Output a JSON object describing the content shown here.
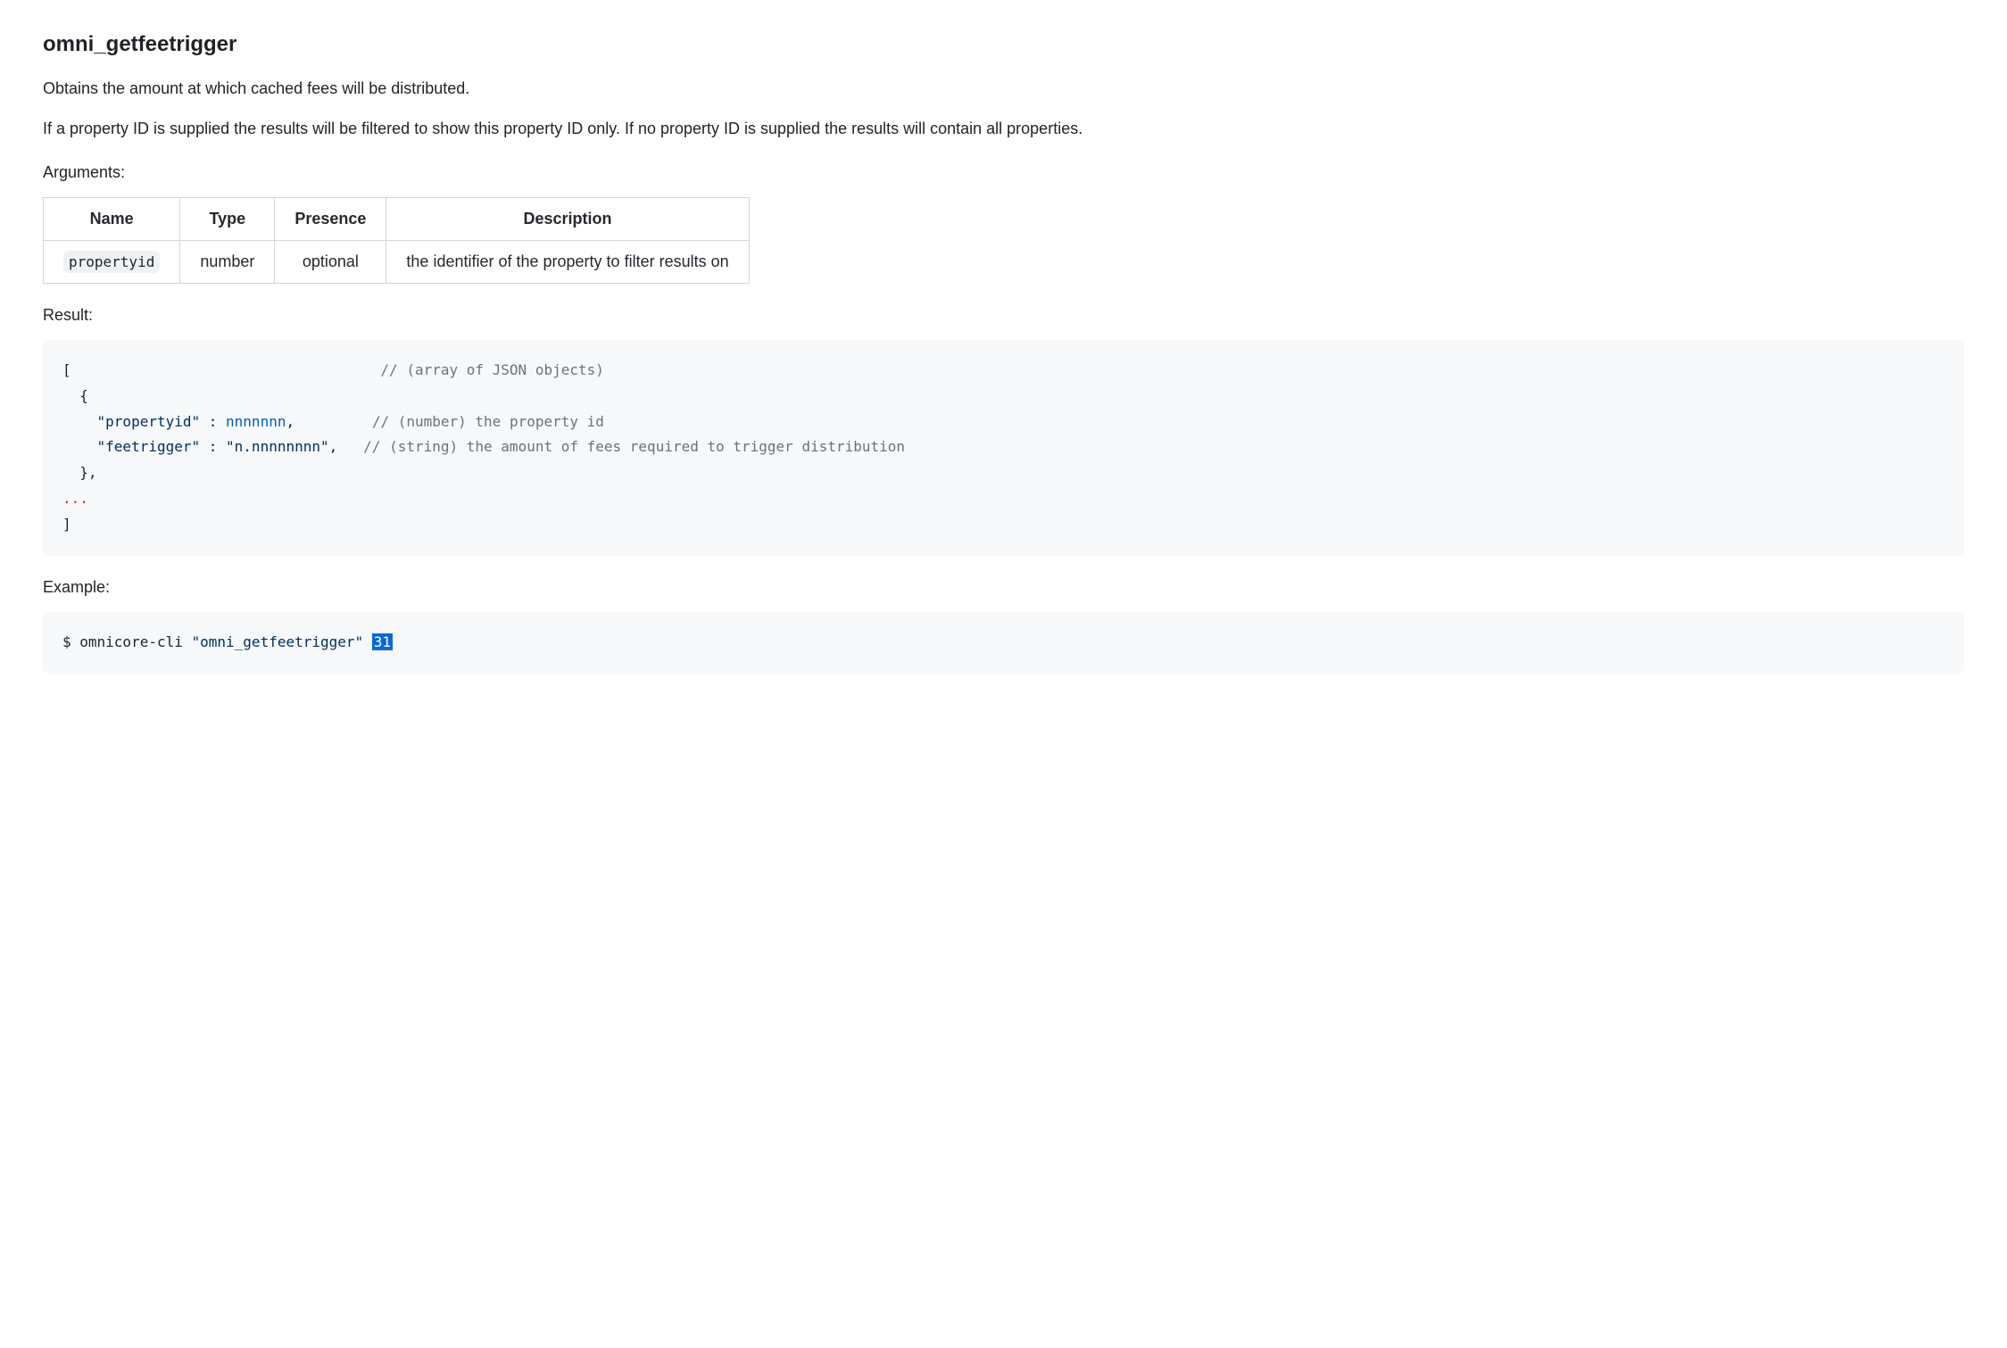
{
  "title": "omni_getfeetrigger",
  "description1": "Obtains the amount at which cached fees will be distributed.",
  "description2": "If a property ID is supplied the results will be filtered to show this property ID only. If no property ID is supplied the results will contain all properties.",
  "sections": {
    "arguments": "Arguments:",
    "result": "Result:",
    "example": "Example:"
  },
  "arguments": {
    "headers": {
      "name": "Name",
      "type": "Type",
      "presence": "Presence",
      "description": "Description"
    },
    "rows": [
      {
        "name": "propertyid",
        "type": "number",
        "presence": "optional",
        "description": "the identifier of the property to filter results on"
      }
    ]
  },
  "result": {
    "l1_open": "[",
    "l1_comment": "// (array of JSON objects)",
    "l2_open": "  {",
    "l3_key": "\"propertyid\"",
    "l3_sep": " : ",
    "l3_val": "nnnnnnn",
    "l3_comma": ",",
    "l3_comment": "// (number) the property id",
    "l4_key": "\"feetrigger\"",
    "l4_sep": " : ",
    "l4_val": "\"n.nnnnnnnn\"",
    "l4_comma": ",",
    "l4_comment": "// (string) the amount of fees required to trigger distribution",
    "l5_close": "  },",
    "l6_ellipsis": "...",
    "l7_close": "]"
  },
  "example": {
    "prompt": "$ ",
    "cmd": "omnicore-cli ",
    "arg1": "\"omni_getfeetrigger\"",
    "space": " ",
    "arg2": "31"
  }
}
